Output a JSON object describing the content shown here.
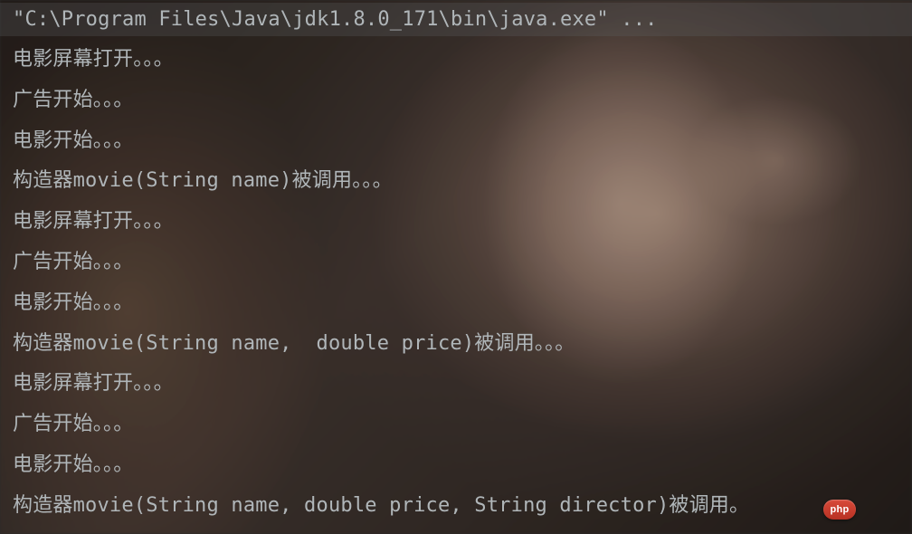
{
  "console": {
    "command": "\"C:\\Program Files\\Java\\jdk1.8.0_171\\bin\\java.exe\" ...",
    "lines": [
      "电影屏幕打开。。。",
      "广告开始。。。",
      "电影开始。。。",
      "构造器movie(String name)被调用。。。",
      "电影屏幕打开。。。",
      "广告开始。。。",
      "电影开始。。。",
      "构造器movie(String name,  double price)被调用。。。",
      "电影屏幕打开。。。",
      "广告开始。。。",
      "电影开始。。。",
      "构造器movie(String name, double price, String director)被调用。"
    ]
  },
  "badge": {
    "label": "php"
  }
}
